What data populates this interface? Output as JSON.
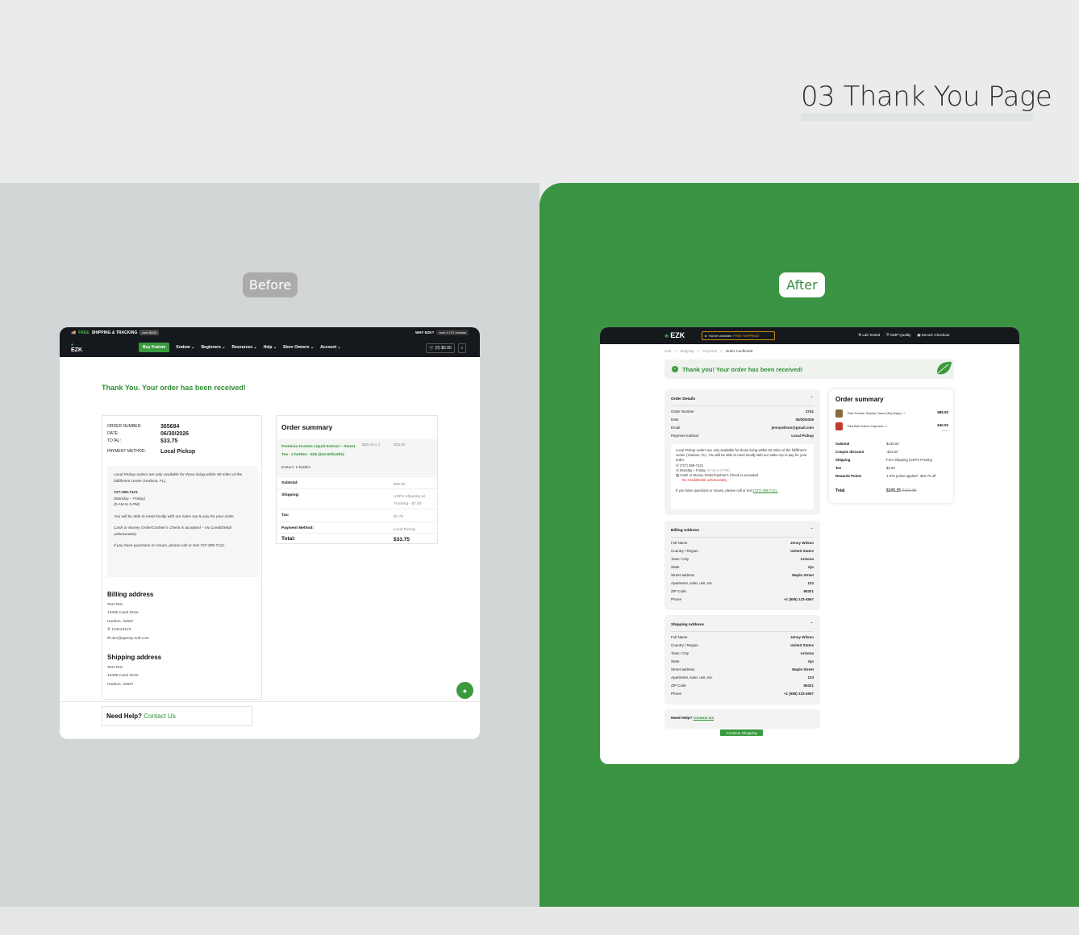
{
  "heading": {
    "title": "03 Thank You Page"
  },
  "labels": {
    "before": "Before",
    "after": "After"
  },
  "before": {
    "topbar": {
      "free": "FREE",
      "shipping": "SHIPPING & TRACKING",
      "over": "over $100",
      "why": "WHY EZK?",
      "reviews": "over 2,747 reviews"
    },
    "logo": "EZK",
    "nav": {
      "buy": "Buy Kratom",
      "items": [
        "Kratom ⌄",
        "Beginners ⌄",
        "Resources ⌄",
        "Help ⌄",
        "Store Owners ⌄",
        "Account ⌄"
      ],
      "cart": "(0) $0.00"
    },
    "thanks": "Thank You. Your order has been received!",
    "overview": {
      "rows": [
        {
          "k": "ORDER NUMBER:",
          "v": "365684"
        },
        {
          "k": "DATE:",
          "v": "06/30/2026"
        },
        {
          "k": "TOTAL:",
          "v": "$33.75"
        },
        {
          "k": "PAYMENT METHOD:",
          "v": "Local Pickup"
        }
      ]
    },
    "note": {
      "p1": "Local Pickup orders are only available for those living within 50 miles of the fulfillment center (Hudson, FL)",
      "phone": "727-389-7121",
      "days": "(Monday – Friday)",
      "hours": "(9 AM to 5 PM)",
      "p3": "You will be able to meet locally with our sales rep to pay for your order.",
      "p4": "Cash or Money Order/Cashier's Check is accepted – No Credit/Debit unfortunately.",
      "p5": "If you have questions or issues, please call or text 727-389-7121."
    },
    "billing": {
      "title": "Billing address",
      "lines": [
        "Test Test",
        "13336 Carol Drive",
        "Hudson, 34667",
        "✆ 123123123",
        "✉ dev@qwerty-soft.com"
      ]
    },
    "shipping": {
      "title": "Shipping address",
      "lines": [
        "Test Test",
        "13336 Carol Drive",
        "Hudson, 34667"
      ]
    },
    "summary": {
      "title": "Order summary",
      "product": {
        "name": "Premium Kratom Liquid Extract – Sweet Tea - 2 bottles - $25 ($12.50/bottle)",
        "extract": "Extract: 2-bottles",
        "qty": "$25.00 x 1",
        "price": "$25.00"
      },
      "rows": [
        {
          "k": "Subtotal:",
          "v": "$25.00"
        },
        {
          "k": "Shipping:",
          "v": "USPS Shipping w/ Tracking - $7.00"
        },
        {
          "k": "Tax:",
          "v": "$1.75"
        },
        {
          "k": "Payment Method:",
          "v": "Local Pickup"
        },
        {
          "k": "Total:",
          "v": "$33.75"
        }
      ]
    },
    "help": {
      "label": "Need Help?",
      "link": "Contact Us"
    }
  },
  "after": {
    "logo": "EZK",
    "free": {
      "prefix": "You've unlocked",
      "highlight": "FREE SHIPPING!"
    },
    "badges": [
      "Lab Tested",
      "GMP Quality",
      "Secure Checkout"
    ],
    "crumbs": [
      "Cart",
      ">",
      "Shipping",
      ">",
      "Payment",
      ">",
      "Order Confirmed"
    ],
    "banner": "Thank you! Your order has been received!",
    "details": {
      "title": "Order Details",
      "rows": [
        {
          "k": "Order Number",
          "v": "2741"
        },
        {
          "k": "Date",
          "v": "06/30/2026"
        },
        {
          "k": "Email",
          "v": "jennywilson@gmail.com"
        },
        {
          "k": "Payment method",
          "v": "Local Pickup"
        }
      ],
      "note": {
        "p1": "Local Pickup orders are only available for those living within 50 miles of the fulfillment center (Hudson, FL). You will be able to meet locally with our sales rep to pay for your order.",
        "phone": "(727) 389-7121",
        "hours": "Monday – Friday",
        "hours2": "(9 AM to 5 PM)",
        "cash": "Cash or Money Order/Cashier's Check is accepted",
        "nocard": "No Credit/Debit unfortunately.",
        "q": "If you have questions or issues, please call or text",
        "qlink": "(727) 389-7121."
      }
    },
    "billing": {
      "title": "Billing Address",
      "rows": [
        {
          "k": "Full Name",
          "v": "Jenny Wilson"
        },
        {
          "k": "Country / Region",
          "v": "United States"
        },
        {
          "k": "Town / City",
          "v": "Arizona"
        },
        {
          "k": "State",
          "v": "Ajo"
        },
        {
          "k": "Street address",
          "v": "Maple Street"
        },
        {
          "k": "Apartment, suite, unit, etc.",
          "v": "123"
        },
        {
          "k": "ZIP Code",
          "v": "85321"
        },
        {
          "k": "Phone",
          "v": "+1 (555) 123-4567"
        }
      ]
    },
    "shipping": {
      "title": "Shipping Address",
      "rows": [
        {
          "k": "Full Name",
          "v": "Jenny Wilson"
        },
        {
          "k": "Country / Region",
          "v": "United States"
        },
        {
          "k": "Town / City",
          "v": "Arizona"
        },
        {
          "k": "State",
          "v": "Ajo"
        },
        {
          "k": "Street address",
          "v": "Maple Street"
        },
        {
          "k": "Apartment, suite, unit, etc.",
          "v": "123"
        },
        {
          "k": "ZIP Code",
          "v": "85321"
        },
        {
          "k": "Phone",
          "v": "+1 (555) 123-4567"
        }
      ]
    },
    "help": {
      "label": "Need Help?",
      "link": "Contact Us"
    },
    "continue": "Continue Shopping",
    "summary": {
      "title": "Order summary",
      "items": [
        {
          "name": "Raw Powder Display Cases (30g Bags)",
          "qty": "x1",
          "price": "$85.00",
          "sub": ""
        },
        {
          "name": "Red Bali Kratom Capsules",
          "qty": "x1",
          "price": "$40.00",
          "sub": "1 case"
        }
      ],
      "rows": [
        {
          "k": "Subtotal",
          "v": "$130.00"
        },
        {
          "k": "Coupon discount",
          "v": "-$15.00"
        },
        {
          "k": "Shipping",
          "v": "Free Shipping (USPS Priority)"
        },
        {
          "k": "Tax",
          "v": "$2.00"
        },
        {
          "k": "Rewards Points",
          "v": "1.075 points applied - $10.75 off"
        }
      ],
      "total": {
        "k": "Total",
        "v": "$105.25",
        "old": "$132.85"
      }
    }
  }
}
